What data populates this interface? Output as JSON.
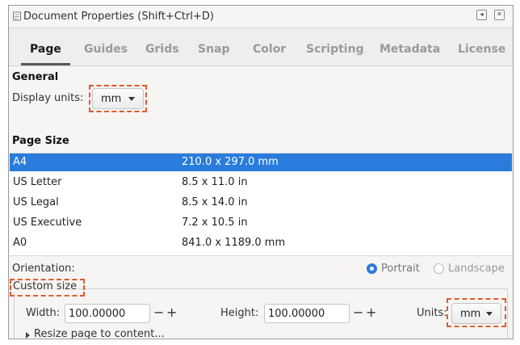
{
  "window": {
    "title": "Document Properties (Shift+Ctrl+D)",
    "minimize_glyph": "◂",
    "close_glyph": "✕"
  },
  "tabs": [
    {
      "label": "Page"
    },
    {
      "label": "Guides"
    },
    {
      "label": "Grids"
    },
    {
      "label": "Snap"
    },
    {
      "label": "Color"
    },
    {
      "label": "Scripting"
    },
    {
      "label": "Metadata"
    },
    {
      "label": "License"
    }
  ],
  "general": {
    "title": "General",
    "display_units_label": "Display units:",
    "display_units_value": "mm"
  },
  "page_size": {
    "title": "Page Size",
    "rows": [
      {
        "name": "A4",
        "size": "210.0 x 297.0 mm"
      },
      {
        "name": "US Letter",
        "size": "8.5 x 11.0 in"
      },
      {
        "name": "US Legal",
        "size": "8.5 x 14.0 in"
      },
      {
        "name": "US Executive",
        "size": "7.2 x 10.5 in"
      },
      {
        "name": "A0",
        "size": "841.0 x 1189.0 mm"
      }
    ],
    "selected_index": 0
  },
  "orientation": {
    "label": "Orientation:",
    "portrait_label": "Portrait",
    "landscape_label": "Landscape",
    "selected": "Portrait"
  },
  "custom_size": {
    "title": "Custom size",
    "width_label": "Width:",
    "width_value": "100.00000",
    "height_label": "Height:",
    "height_value": "100.00000",
    "units_label": "Units:",
    "units_value": "mm",
    "minus": "−",
    "plus": "+"
  },
  "resize": {
    "label": "Resize page to content..."
  },
  "colors": {
    "selection": "#2a7cdc",
    "highlight": "#e05a2d"
  }
}
